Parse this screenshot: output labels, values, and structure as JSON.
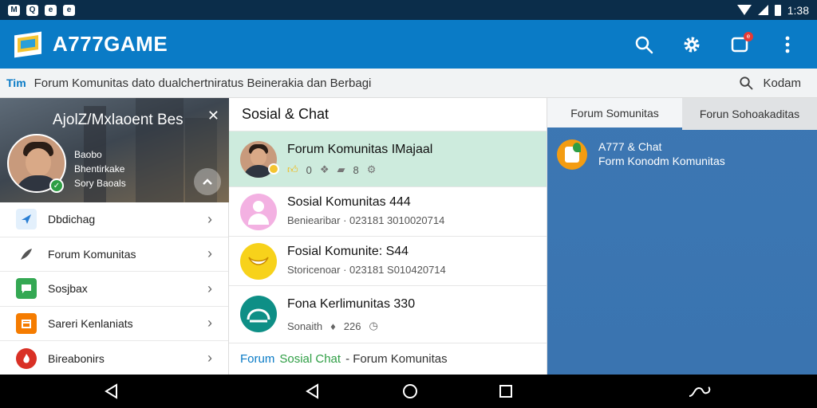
{
  "status_bar": {
    "left_icons": [
      "M",
      "Q",
      "e",
      "e"
    ],
    "time": "1:38"
  },
  "app_bar": {
    "title": "A777GAME",
    "badge": "e"
  },
  "subheader": {
    "prefix": "Tim",
    "text": "Forum Komunitas dato dualchertniratus Beinerakia dan Berbagi",
    "search_label": "Kodam"
  },
  "drawer": {
    "profile": {
      "name": "AjolZ/Mxlaoent Bes",
      "info": [
        "Baobo",
        "Bhentirkake",
        "Sory Baoals"
      ]
    },
    "items": [
      {
        "label": "Dbdichag",
        "icon": "arrow-icon",
        "color": "#2a7fd4"
      },
      {
        "label": "Forum Komunitas",
        "icon": "feather-icon",
        "color": "#555555"
      },
      {
        "label": "Sosjbax",
        "icon": "chat-icon",
        "color": "#34a853"
      },
      {
        "label": "Sareri Kenlaniats",
        "icon": "calendar-icon",
        "color": "#f57c00"
      },
      {
        "label": "Bireabonirs",
        "icon": "flame-icon",
        "color": "#d93025"
      }
    ]
  },
  "chat": {
    "title": "Sosial & Chat",
    "rows": [
      {
        "title": "Forum Komunitas IMajaal",
        "sub": [
          "0",
          "8"
        ]
      },
      {
        "title": "Sosial Komunitas 444",
        "sub": [
          "Beniearibar · 023181 3010020714"
        ]
      },
      {
        "title": "Fosial Komunite: S44",
        "sub": [
          "Storicenoar · 023181 S010420714"
        ]
      },
      {
        "title": "Fona Kerlimunitas 330",
        "sub": [
          "Sonaith",
          "226"
        ]
      }
    ],
    "footer": {
      "forum": "Forum",
      "sosial": "Sosial Chat",
      "rest": "- Forum Komunitas"
    }
  },
  "right": {
    "tabs": [
      "Forum Somunitas",
      "Forun Sohoakaditas"
    ],
    "item": {
      "title": "A777 & Chat",
      "sub": "Form Konodm Komunitas"
    }
  },
  "colors": {
    "appbar": "#0a7bc6",
    "status": "#0b2d4a",
    "accent_green": "#2e9e44",
    "right_panel": "#3c77b3"
  }
}
